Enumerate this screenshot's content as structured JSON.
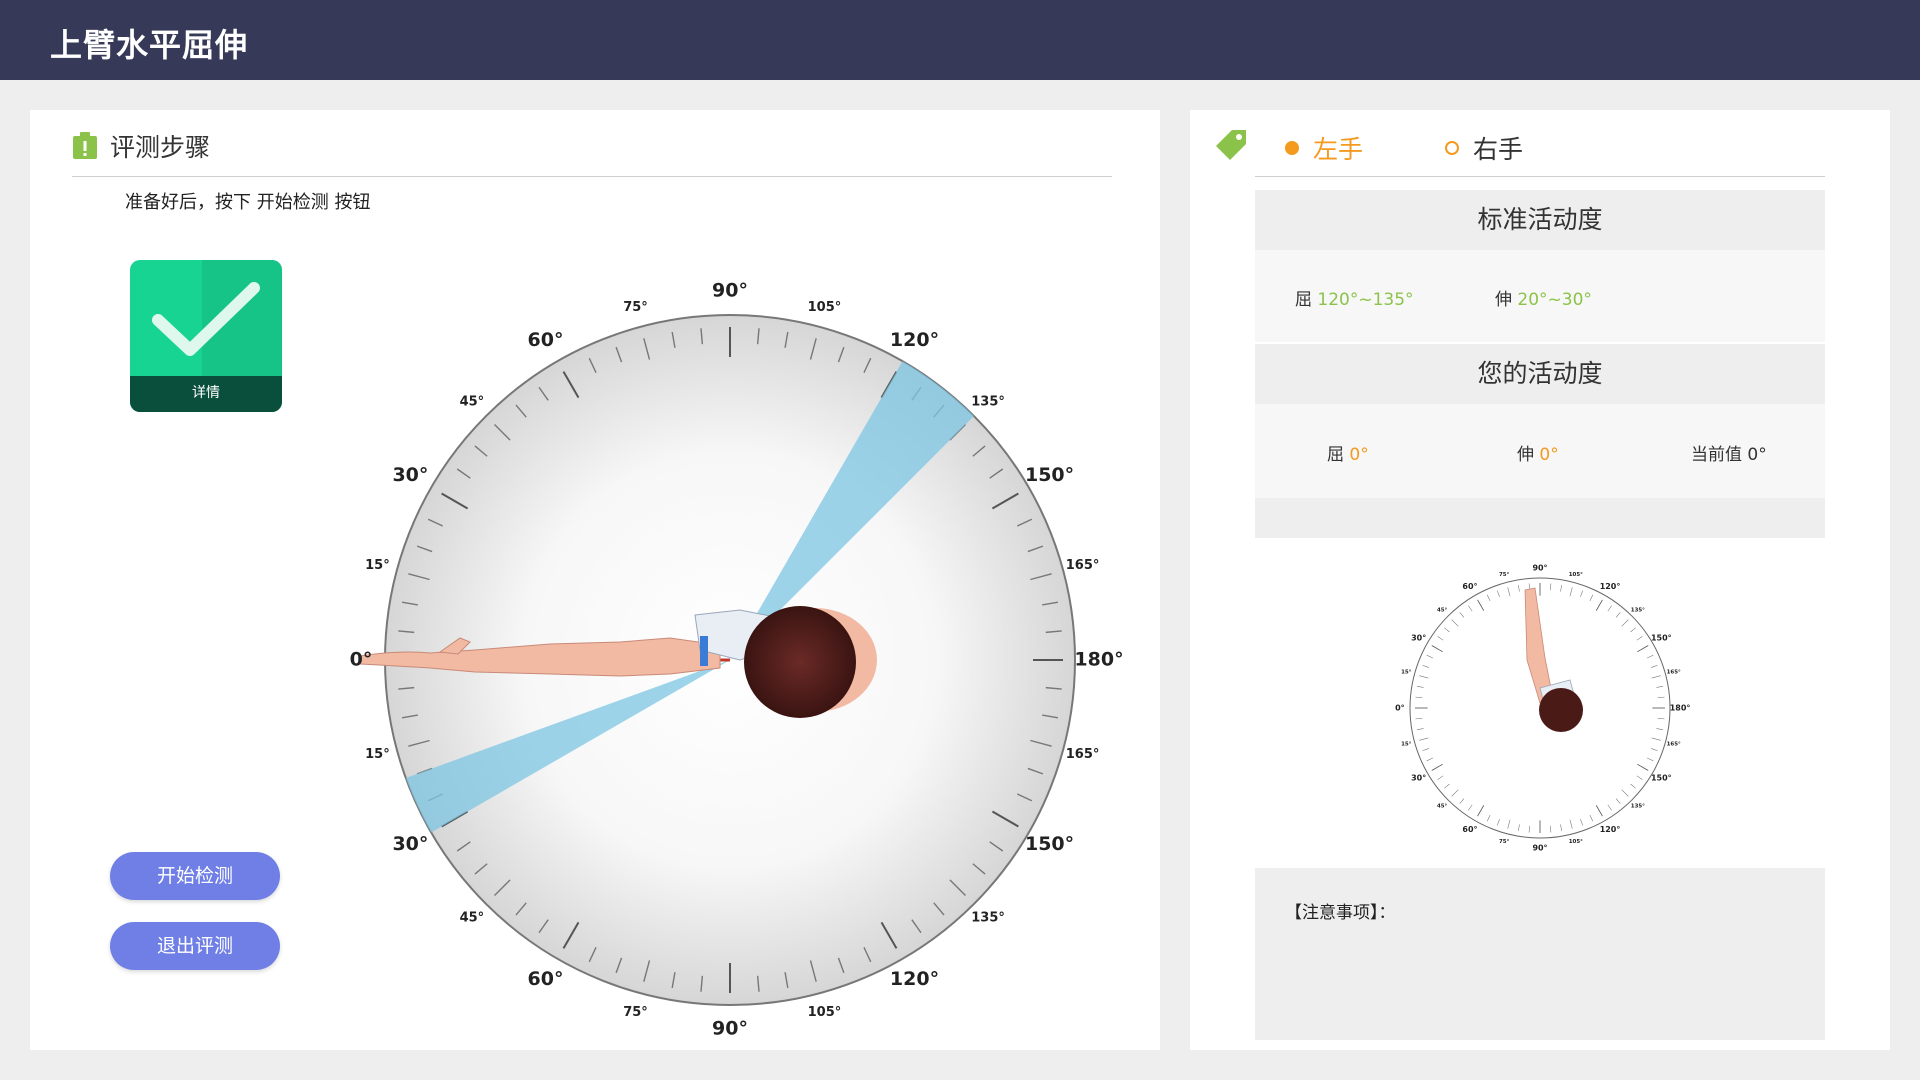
{
  "header": {
    "title": "上臂水平屈伸"
  },
  "steps": {
    "title": "评测步骤",
    "instruction": "准备好后，按下 开始检测 按钮",
    "detail_label": "详情",
    "start_button": "开始检测",
    "exit_button": "退出评测"
  },
  "gauge": {
    "labels_major": [
      "0°",
      "30°",
      "60°",
      "90°",
      "120°",
      "150°",
      "180°"
    ],
    "labels_minor": [
      "15°",
      "45°",
      "75°",
      "105°",
      "135°",
      "165°"
    ],
    "current_angle_deg": 0,
    "highlight_ranges_deg": [
      [
        120,
        135
      ],
      [
        20,
        30
      ]
    ]
  },
  "side_select": {
    "left": "左手",
    "right": "右手",
    "selected": "left"
  },
  "standard": {
    "title": "标准活动度",
    "flex_label": "屈",
    "flex_value": "120°~135°",
    "ext_label": "伸",
    "ext_value": "20°~30°"
  },
  "yours": {
    "title": "您的活动度",
    "flex_label": "屈",
    "flex_value": "0°",
    "ext_label": "伸",
    "ext_value": "0°",
    "current_label": "当前值 0°"
  },
  "notes": {
    "label": "【注意事项】："
  },
  "colors": {
    "topbar": "#363958",
    "accent_orange": "#f39a1f",
    "accent_green": "#8bc34a",
    "button": "#6f7fe5",
    "detail": "#18d493",
    "highlight": "#7cc6e3"
  }
}
